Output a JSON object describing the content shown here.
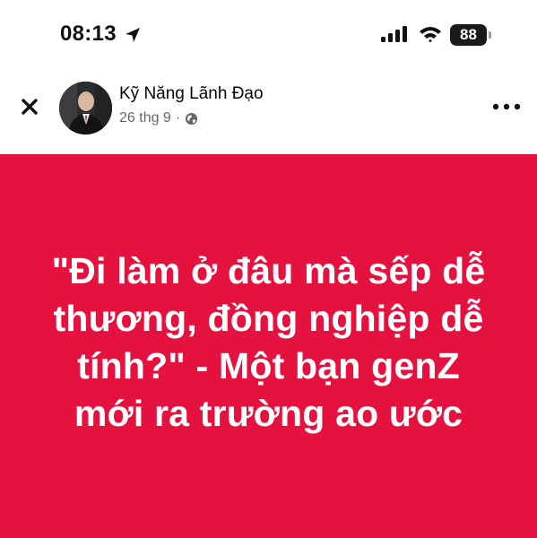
{
  "status_bar": {
    "time": "08:13",
    "location_icon": "location-arrow-icon",
    "signal_icon": "cellular-signal-icon",
    "wifi_icon": "wifi-icon",
    "battery_level": "88"
  },
  "post_header": {
    "close_icon": "close-icon",
    "author_name": "Kỹ Năng Lãnh Đạo",
    "date": "26 thg 9",
    "separator": "·",
    "privacy_icon": "globe-icon",
    "more_icon": "more-horizontal-icon"
  },
  "post": {
    "background_color": "#e5113e",
    "text_color": "#ffffff",
    "lines": [
      "\"Đi làm ở đâu mà sếp dễ",
      "thương, đồng nghiệp dễ",
      "tính?\" - Một bạn genZ",
      "mới ra trường ao ước"
    ]
  }
}
